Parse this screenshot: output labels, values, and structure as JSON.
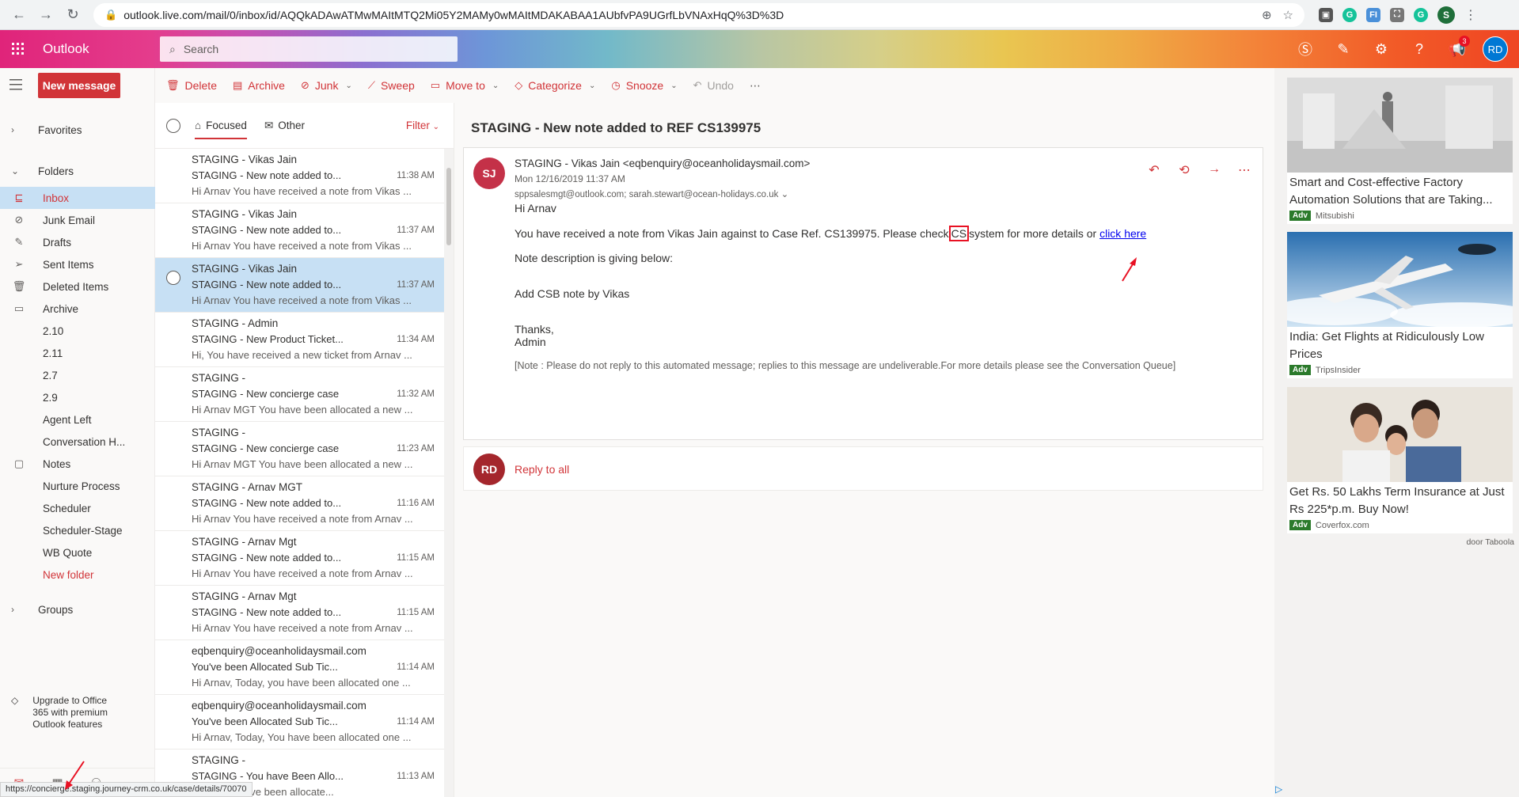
{
  "browser": {
    "url": "outlook.live.com/mail/0/inbox/id/AQQkADAwATMwMAItMTQ2Mi05Y2MAMy0wMAItMDAKABAA1AUbfvPA9UGrfLbVNAxHqQ%3D%3D",
    "profile_initial": "S"
  },
  "header": {
    "brand": "Outlook",
    "search_placeholder": "Search",
    "notification_count": "3",
    "user_initials": "RD"
  },
  "leftnav": {
    "new_message": "New message",
    "favorites": "Favorites",
    "folders": "Folders",
    "items": [
      {
        "label": "Inbox"
      },
      {
        "label": "Junk Email"
      },
      {
        "label": "Drafts"
      },
      {
        "label": "Sent Items"
      },
      {
        "label": "Deleted Items"
      },
      {
        "label": "Archive"
      },
      {
        "label": "2.10"
      },
      {
        "label": "2.11"
      },
      {
        "label": "2.7"
      },
      {
        "label": "2.9"
      },
      {
        "label": "Agent Left"
      },
      {
        "label": "Conversation H..."
      },
      {
        "label": "Notes"
      },
      {
        "label": "Nurture Process"
      },
      {
        "label": "Scheduler"
      },
      {
        "label": "Scheduler-Stage"
      },
      {
        "label": "WB Quote"
      },
      {
        "label": "New folder"
      }
    ],
    "groups": "Groups",
    "upgrade": "Upgrade to Office 365 with premium Outlook features"
  },
  "status_url": "https://concierge.staging.journey-crm.co.uk/case/details/70070",
  "toolbar": {
    "delete": "Delete",
    "archive": "Archive",
    "junk": "Junk",
    "sweep": "Sweep",
    "move_to": "Move to",
    "categorize": "Categorize",
    "snooze": "Snooze",
    "undo": "Undo"
  },
  "list": {
    "tab_focused": "Focused",
    "tab_other": "Other",
    "filter": "Filter",
    "messages": [
      {
        "from": "STAGING - Vikas Jain",
        "subject": "STAGING - New note added to...",
        "time": "11:38 AM",
        "preview": "Hi Arnav You have received a note from Vikas ..."
      },
      {
        "from": "STAGING - Vikas Jain",
        "subject": "STAGING - New note added to...",
        "time": "11:37 AM",
        "preview": "Hi Arnav You have received a note from Vikas ..."
      },
      {
        "from": "STAGING - Vikas Jain",
        "subject": "STAGING - New note added to...",
        "time": "11:37 AM",
        "preview": "Hi Arnav You have received a note from Vikas ..."
      },
      {
        "from": "STAGING - Admin",
        "subject": "STAGING - New Product Ticket...",
        "time": "11:34 AM",
        "preview": "Hi, You have received a new ticket from Arnav ..."
      },
      {
        "from": "STAGING -",
        "subject": "STAGING - New concierge case",
        "time": "11:32 AM",
        "preview": "Hi Arnav MGT You have been allocated a new ..."
      },
      {
        "from": "STAGING -",
        "subject": "STAGING - New concierge case",
        "time": "11:23 AM",
        "preview": "Hi Arnav MGT You have been allocated a new ..."
      },
      {
        "from": "STAGING - Arnav MGT",
        "subject": "STAGING - New note added to...",
        "time": "11:16 AM",
        "preview": "Hi Arnav You have received a note from Arnav ..."
      },
      {
        "from": "STAGING - Arnav Mgt",
        "subject": "STAGING - New note added to...",
        "time": "11:15 AM",
        "preview": "Hi Arnav You have received a note from Arnav ..."
      },
      {
        "from": "STAGING - Arnav Mgt",
        "subject": "STAGING - New note added to...",
        "time": "11:15 AM",
        "preview": "Hi Arnav You have received a note from Arnav ..."
      },
      {
        "from": "eqbenquiry@oceanholidaysmail.com",
        "subject": "You've been Allocated Sub Tic...",
        "time": "11:14 AM",
        "preview": "Hi Arnav, Today, you have been allocated one ..."
      },
      {
        "from": "eqbenquiry@oceanholidaysmail.com",
        "subject": "You've been Allocated Sub Tic...",
        "time": "11:14 AM",
        "preview": "Hi Arnav, Today, You have been allocated one ..."
      },
      {
        "from": "STAGING -",
        "subject": "STAGING - You have Been Allo...",
        "time": "11:13 AM",
        "preview": "oday, You have been allocate..."
      }
    ]
  },
  "reading": {
    "subject": "STAGING - New note added to REF CS139975",
    "sender_initials": "SJ",
    "sender": "STAGING - Vikas Jain <eqbenquiry@oceanholidaysmail.com>",
    "date": "Mon 12/16/2019 11:37 AM",
    "to": "sppsalesmgt@outlook.com; sarah.stewart@ocean-holidays.co.uk",
    "greeting": "Hi Arnav",
    "line1_before": "You have received a note from Vikas Jain against to Case Ref. CS139975. Please check",
    "line1_cs": "CS",
    "line1_after": "system for more details or",
    "link": "click here",
    "line2": "Note description is giving below:",
    "line3": "Add CSB note by Vikas",
    "thanks": "Thanks,",
    "signoff": "Admin",
    "note": "[Note : Please do not reply to this automated message; replies to this message are undeliverable.For more details please see the Conversation Queue]",
    "reply_initials": "RD",
    "reply_all": "Reply to all"
  },
  "ads": [
    {
      "title": "Smart and Cost-effective Factory Automation Solutions that are Taking...",
      "badge": "Adv",
      "source": "Mitsubishi"
    },
    {
      "title": "India: Get Flights at Ridiculously Low Prices",
      "badge": "Adv",
      "source": "TripsInsider"
    },
    {
      "title": "Get Rs. 50 Lakhs Term Insurance at Just Rs 225*p.m. Buy Now!",
      "badge": "Adv",
      "source": "Coverfox.com"
    }
  ],
  "taboola": "door Taboola",
  "colors": {
    "accent": "#d13438",
    "selected": "#c7e0f4",
    "link": "#0000ee"
  }
}
